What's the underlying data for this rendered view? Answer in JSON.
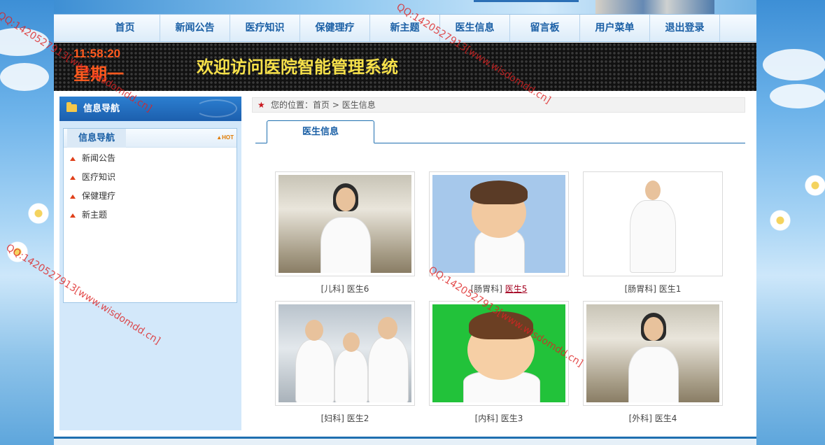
{
  "nav": {
    "items": [
      "首页",
      "新闻公告",
      "医疗知识",
      "保健理疗",
      "新主题",
      "医生信息",
      "留言板",
      "用户菜单",
      "退出登录"
    ]
  },
  "marquee": {
    "time": "11:58:20",
    "weekday": "星期一",
    "welcome": "欢迎访问医院智能管理系统"
  },
  "sidebar": {
    "header": "信息导航",
    "box_title": "信息导航",
    "hot_label": "HOT",
    "items": [
      "新闻公告",
      "医疗知识",
      "保健理疗",
      "新主题"
    ]
  },
  "breadcrumb": {
    "prefix": "您的位置：",
    "home": "首页",
    "separator": ">",
    "current": "医生信息"
  },
  "tab": {
    "label": "医生信息"
  },
  "doctors": [
    {
      "dept": "[儿科]",
      "name": "医生6"
    },
    {
      "dept": "[肠胃科]",
      "name": "医生5"
    },
    {
      "dept": "[肠胃科]",
      "name": "医生1"
    },
    {
      "dept": "[妇科]",
      "name": "医生2"
    },
    {
      "dept": "[内科]",
      "name": "医生3"
    },
    {
      "dept": "[外科]",
      "name": "医生4"
    }
  ],
  "watermark": "QQ:1420527913[www.wisdomdd.cn]",
  "colors": {
    "nav_text": "#1a5fa5",
    "clock": "#ff5a1f",
    "welcome": "#f7e14a",
    "active_link": "#a3001e"
  }
}
